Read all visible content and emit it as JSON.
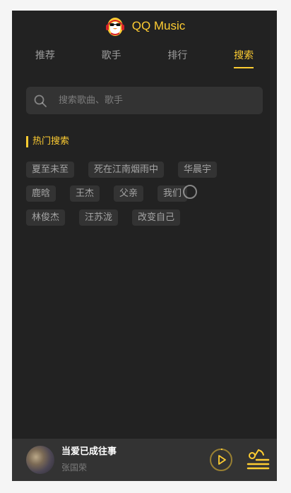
{
  "app": {
    "title": "QQ Music"
  },
  "tabs": [
    {
      "label": "推荐",
      "active": false
    },
    {
      "label": "歌手",
      "active": false
    },
    {
      "label": "排行",
      "active": false
    },
    {
      "label": "搜索",
      "active": true
    }
  ],
  "search": {
    "placeholder": "搜索歌曲、歌手",
    "value": ""
  },
  "hot": {
    "title": "热门搜索",
    "rows": [
      [
        "夏至未至",
        "死在江南烟雨中",
        "华晨宇"
      ],
      [
        "鹿晗",
        "王杰",
        "父亲",
        "我们"
      ],
      [
        "林俊杰",
        "汪苏泷",
        "改变自己"
      ]
    ]
  },
  "player": {
    "song": "当爱已成往事",
    "singer": "张国荣",
    "progress": 0.02
  },
  "icons": {
    "logo": "qq-music-penguin-icon",
    "search": "search-icon",
    "play": "play-icon",
    "playlist": "playlist-icon"
  },
  "colors": {
    "accent": "#ffcd32",
    "background": "#222222",
    "surface": "#333333"
  }
}
